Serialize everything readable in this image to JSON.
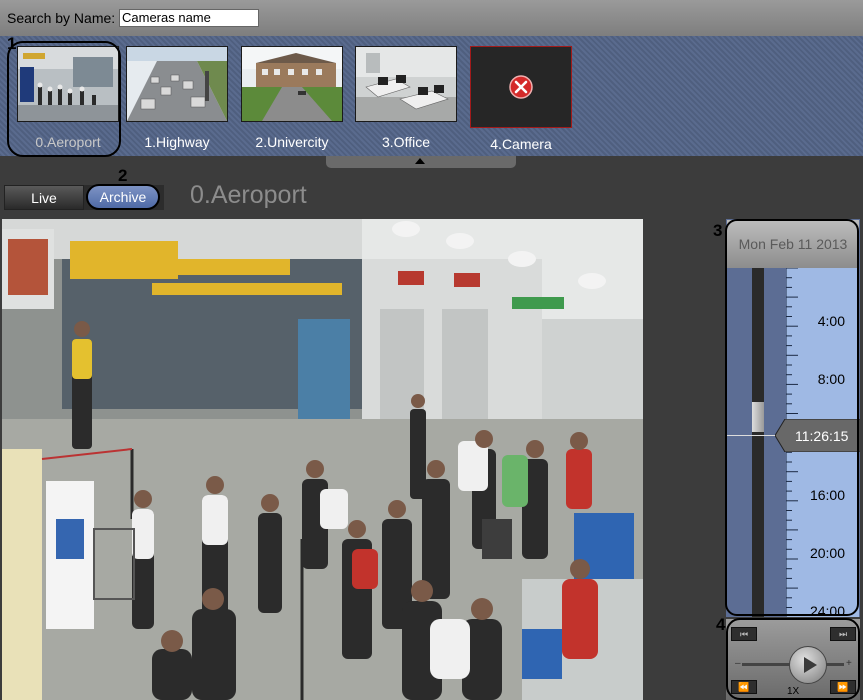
{
  "search": {
    "label": "Search by Name:",
    "placeholder": "Cameras name"
  },
  "cameras": [
    {
      "label": "0.Aeroport",
      "selected": true
    },
    {
      "label": "1.Highway",
      "selected": false
    },
    {
      "label": "2.Univercity",
      "selected": false
    },
    {
      "label": "3.Office",
      "selected": false
    },
    {
      "label": "4.Camera",
      "selected": false,
      "error": true
    }
  ],
  "callouts": [
    "1",
    "2",
    "3",
    "4"
  ],
  "modes": {
    "live_label": "Live",
    "archive_label": "Archive",
    "active": "Archive"
  },
  "current_camera": "0.Aeroport",
  "timeline": {
    "date": "Mon Feb 11 2013",
    "hours": [
      "4:00",
      "8:00",
      "16:00",
      "20:00",
      "24:00"
    ],
    "current_time": "11:26:15"
  },
  "player": {
    "speed": "1X"
  },
  "colors": {
    "strip": "#5a6b8e",
    "archive_active": "#5f7bb8",
    "timeline_scale": "#9fb9e4",
    "error_icon": "#d42a2a"
  }
}
